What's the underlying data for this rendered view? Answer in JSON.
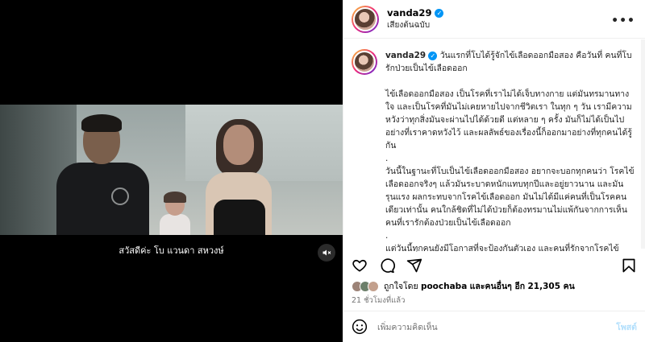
{
  "media": {
    "subtitle": "สวัสดีค่ะ โบ แวนดา สหวงษ์",
    "mute_icon": "speaker-muted-icon"
  },
  "header": {
    "username": "vanda29",
    "audio": "เสียงต้นฉบับ",
    "more_icon": "more-dots-icon"
  },
  "caption": {
    "username": "vanda29",
    "paragraphs": [
      "วันแรกที่โบได้รู้จักไข้เลือดออกมือสอง คือวันที่ คนที่โบรักป่วยเป็นไข้เลือดออก",
      "ไข้เลือดออกมือสอง เป็นโรคที่เราไม่ได้เจ็บทางกาย แต่มันทรมานทางใจ และเป็นโรคที่มันไม่เคยหายไปจากชีวิตเรา ในทุก ๆ วัน เรามีความหวังว่าทุกสิ่งมันจะผ่านไปได้ด้วยดี แต่หลาย ๆ ครั้ง มันก็ไม่ได้เป็นไปอย่างที่เราคาดหวังไว้ และผลลัพธ์ของเรื่องนี้ก็ออกมาอย่างที่ทุกคนได้รู้กัน",
      ".",
      "วันนี้ในฐานะที่โบเป็นไข้เลือดออกมือสอง อยากจะบอกทุกคนว่า โรคไข้เลือดออกจริงๆ แล้วมันระบาดหนักแทบทุกปีและอยู่ยาวนาน และมันรุนแรง ผลกระทบจากโรคไข้เลือดออก มันไม่ได้มีแค่คนที่เป็นโรคคนเดียวเท่านั้น คนใกล้ชิดที่ไม่ได้ป่วยก็ต้องทรมานไม่แพ้กันจากการเห็นคนที่เรารักต้องป่วยเป็นไข้เลือดออก",
      ".",
      "แต่วันนี้ทุกคนยังมีโอกาสที่จะป้องกันตัวเอง และคนที่รักจากโรคไข้เลือดออกนะคะ เพื่อที่จะได้ไม่ต้องมีใครมาเป็น \"ไข้เลือดออกมือสอง\" เหมือนกับโบ"
    ]
  },
  "actions": {
    "like_icon": "heart-icon",
    "comment_icon": "comment-icon",
    "share_icon": "share-icon",
    "save_icon": "bookmark-icon"
  },
  "likes": {
    "text_prefix": "ถูกใจโดย",
    "liked_by": "poochaba",
    "text_mid": "และคนอื่นๆ อีก",
    "count": "21,305 คน"
  },
  "timestamp": "21 ชั่วโมงที่แล้ว",
  "comment_box": {
    "placeholder": "เพิ่มความคิดเห็น",
    "post_label": "โพสต์",
    "emoji_icon": "smiley-icon"
  }
}
